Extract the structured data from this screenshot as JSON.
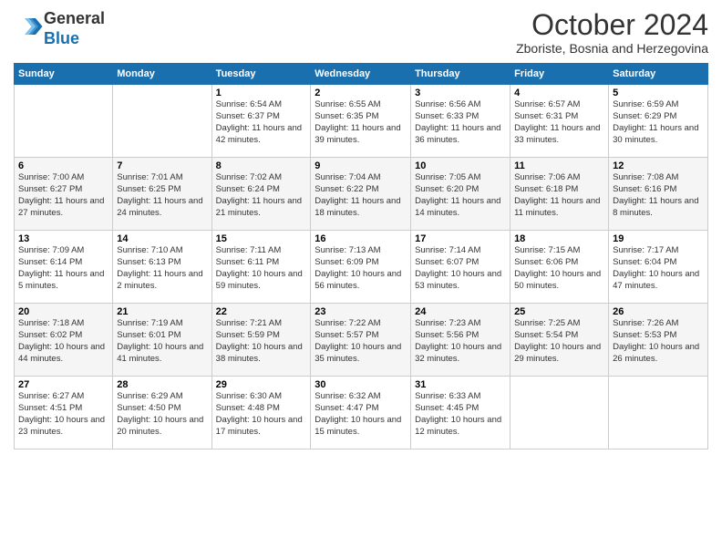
{
  "header": {
    "logo_line1": "General",
    "logo_line2": "Blue",
    "month": "October 2024",
    "location": "Zboriste, Bosnia and Herzegovina"
  },
  "days_of_week": [
    "Sunday",
    "Monday",
    "Tuesday",
    "Wednesday",
    "Thursday",
    "Friday",
    "Saturday"
  ],
  "weeks": [
    [
      {
        "day": "",
        "sunrise": "",
        "sunset": "",
        "daylight": ""
      },
      {
        "day": "",
        "sunrise": "",
        "sunset": "",
        "daylight": ""
      },
      {
        "day": "1",
        "sunrise": "Sunrise: 6:54 AM",
        "sunset": "Sunset: 6:37 PM",
        "daylight": "Daylight: 11 hours and 42 minutes."
      },
      {
        "day": "2",
        "sunrise": "Sunrise: 6:55 AM",
        "sunset": "Sunset: 6:35 PM",
        "daylight": "Daylight: 11 hours and 39 minutes."
      },
      {
        "day": "3",
        "sunrise": "Sunrise: 6:56 AM",
        "sunset": "Sunset: 6:33 PM",
        "daylight": "Daylight: 11 hours and 36 minutes."
      },
      {
        "day": "4",
        "sunrise": "Sunrise: 6:57 AM",
        "sunset": "Sunset: 6:31 PM",
        "daylight": "Daylight: 11 hours and 33 minutes."
      },
      {
        "day": "5",
        "sunrise": "Sunrise: 6:59 AM",
        "sunset": "Sunset: 6:29 PM",
        "daylight": "Daylight: 11 hours and 30 minutes."
      }
    ],
    [
      {
        "day": "6",
        "sunrise": "Sunrise: 7:00 AM",
        "sunset": "Sunset: 6:27 PM",
        "daylight": "Daylight: 11 hours and 27 minutes."
      },
      {
        "day": "7",
        "sunrise": "Sunrise: 7:01 AM",
        "sunset": "Sunset: 6:25 PM",
        "daylight": "Daylight: 11 hours and 24 minutes."
      },
      {
        "day": "8",
        "sunrise": "Sunrise: 7:02 AM",
        "sunset": "Sunset: 6:24 PM",
        "daylight": "Daylight: 11 hours and 21 minutes."
      },
      {
        "day": "9",
        "sunrise": "Sunrise: 7:04 AM",
        "sunset": "Sunset: 6:22 PM",
        "daylight": "Daylight: 11 hours and 18 minutes."
      },
      {
        "day": "10",
        "sunrise": "Sunrise: 7:05 AM",
        "sunset": "Sunset: 6:20 PM",
        "daylight": "Daylight: 11 hours and 14 minutes."
      },
      {
        "day": "11",
        "sunrise": "Sunrise: 7:06 AM",
        "sunset": "Sunset: 6:18 PM",
        "daylight": "Daylight: 11 hours and 11 minutes."
      },
      {
        "day": "12",
        "sunrise": "Sunrise: 7:08 AM",
        "sunset": "Sunset: 6:16 PM",
        "daylight": "Daylight: 11 hours and 8 minutes."
      }
    ],
    [
      {
        "day": "13",
        "sunrise": "Sunrise: 7:09 AM",
        "sunset": "Sunset: 6:14 PM",
        "daylight": "Daylight: 11 hours and 5 minutes."
      },
      {
        "day": "14",
        "sunrise": "Sunrise: 7:10 AM",
        "sunset": "Sunset: 6:13 PM",
        "daylight": "Daylight: 11 hours and 2 minutes."
      },
      {
        "day": "15",
        "sunrise": "Sunrise: 7:11 AM",
        "sunset": "Sunset: 6:11 PM",
        "daylight": "Daylight: 10 hours and 59 minutes."
      },
      {
        "day": "16",
        "sunrise": "Sunrise: 7:13 AM",
        "sunset": "Sunset: 6:09 PM",
        "daylight": "Daylight: 10 hours and 56 minutes."
      },
      {
        "day": "17",
        "sunrise": "Sunrise: 7:14 AM",
        "sunset": "Sunset: 6:07 PM",
        "daylight": "Daylight: 10 hours and 53 minutes."
      },
      {
        "day": "18",
        "sunrise": "Sunrise: 7:15 AM",
        "sunset": "Sunset: 6:06 PM",
        "daylight": "Daylight: 10 hours and 50 minutes."
      },
      {
        "day": "19",
        "sunrise": "Sunrise: 7:17 AM",
        "sunset": "Sunset: 6:04 PM",
        "daylight": "Daylight: 10 hours and 47 minutes."
      }
    ],
    [
      {
        "day": "20",
        "sunrise": "Sunrise: 7:18 AM",
        "sunset": "Sunset: 6:02 PM",
        "daylight": "Daylight: 10 hours and 44 minutes."
      },
      {
        "day": "21",
        "sunrise": "Sunrise: 7:19 AM",
        "sunset": "Sunset: 6:01 PM",
        "daylight": "Daylight: 10 hours and 41 minutes."
      },
      {
        "day": "22",
        "sunrise": "Sunrise: 7:21 AM",
        "sunset": "Sunset: 5:59 PM",
        "daylight": "Daylight: 10 hours and 38 minutes."
      },
      {
        "day": "23",
        "sunrise": "Sunrise: 7:22 AM",
        "sunset": "Sunset: 5:57 PM",
        "daylight": "Daylight: 10 hours and 35 minutes."
      },
      {
        "day": "24",
        "sunrise": "Sunrise: 7:23 AM",
        "sunset": "Sunset: 5:56 PM",
        "daylight": "Daylight: 10 hours and 32 minutes."
      },
      {
        "day": "25",
        "sunrise": "Sunrise: 7:25 AM",
        "sunset": "Sunset: 5:54 PM",
        "daylight": "Daylight: 10 hours and 29 minutes."
      },
      {
        "day": "26",
        "sunrise": "Sunrise: 7:26 AM",
        "sunset": "Sunset: 5:53 PM",
        "daylight": "Daylight: 10 hours and 26 minutes."
      }
    ],
    [
      {
        "day": "27",
        "sunrise": "Sunrise: 6:27 AM",
        "sunset": "Sunset: 4:51 PM",
        "daylight": "Daylight: 10 hours and 23 minutes."
      },
      {
        "day": "28",
        "sunrise": "Sunrise: 6:29 AM",
        "sunset": "Sunset: 4:50 PM",
        "daylight": "Daylight: 10 hours and 20 minutes."
      },
      {
        "day": "29",
        "sunrise": "Sunrise: 6:30 AM",
        "sunset": "Sunset: 4:48 PM",
        "daylight": "Daylight: 10 hours and 17 minutes."
      },
      {
        "day": "30",
        "sunrise": "Sunrise: 6:32 AM",
        "sunset": "Sunset: 4:47 PM",
        "daylight": "Daylight: 10 hours and 15 minutes."
      },
      {
        "day": "31",
        "sunrise": "Sunrise: 6:33 AM",
        "sunset": "Sunset: 4:45 PM",
        "daylight": "Daylight: 10 hours and 12 minutes."
      },
      {
        "day": "",
        "sunrise": "",
        "sunset": "",
        "daylight": ""
      },
      {
        "day": "",
        "sunrise": "",
        "sunset": "",
        "daylight": ""
      }
    ]
  ]
}
